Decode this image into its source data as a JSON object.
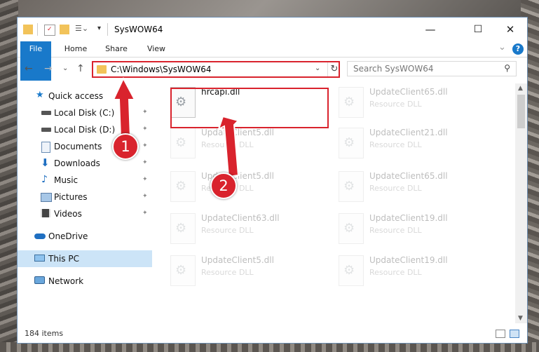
{
  "window": {
    "title": "SysWOW64",
    "controls": {
      "minimize": "—",
      "maximize": "☐",
      "close": "✕"
    }
  },
  "ribbon": {
    "tabs": [
      "File",
      "Home",
      "Share",
      "View"
    ],
    "expand_glyph": "⌄",
    "help_glyph": "?"
  },
  "address_bar": {
    "path": "C:\\Windows\\SysWOW64",
    "dropdown_glyph": "⌄",
    "refresh_glyph": "↻"
  },
  "search": {
    "placeholder": "Search SysWOW64",
    "icon_glyph": "⚲"
  },
  "nav_buttons": {
    "back": "←",
    "forward": "→",
    "recent": "⌄",
    "up": "↑"
  },
  "sidebar": {
    "items": [
      {
        "label": "Quick access",
        "icon": "star-icon",
        "pinned": false
      },
      {
        "label": "Local Disk (C:)",
        "icon": "drive-icon",
        "pinned": true
      },
      {
        "label": "Local Disk (D:)",
        "icon": "drive-icon",
        "pinned": true
      },
      {
        "label": "Documents",
        "icon": "documents-icon",
        "pinned": true
      },
      {
        "label": "Downloads",
        "icon": "download-icon",
        "pinned": true
      },
      {
        "label": "Music",
        "icon": "music-icon",
        "pinned": true
      },
      {
        "label": "Pictures",
        "icon": "pictures-icon",
        "pinned": true
      },
      {
        "label": "Videos",
        "icon": "videos-icon",
        "pinned": true
      },
      {
        "label": "OneDrive",
        "icon": "cloud-icon",
        "pinned": false
      },
      {
        "label": "This PC",
        "icon": "computer-icon",
        "pinned": false,
        "selected": true
      },
      {
        "label": "Network",
        "icon": "network-icon",
        "pinned": false
      }
    ],
    "pin_glyph": "✦"
  },
  "files": [
    {
      "name": "hrcapi.dll",
      "type": "",
      "highlighted": true
    },
    {
      "name": "UpdateClient65.dll",
      "type": "Resource DLL"
    },
    {
      "name": "UpdateClient5.dll",
      "type": "Resource DLL"
    },
    {
      "name": "UpdateClient21.dll",
      "type": "Resource DLL"
    },
    {
      "name": "UpdateClient5.dll",
      "type": "Resource DLL"
    },
    {
      "name": "UpdateClient65.dll",
      "type": "Resource DLL"
    },
    {
      "name": "UpdateClient63.dll",
      "type": "Resource DLL"
    },
    {
      "name": "UpdateClient19.dll",
      "type": "Resource DLL"
    },
    {
      "name": "UpdateClient5.dll",
      "type": "Resource DLL"
    },
    {
      "name": "UpdateClient19.dll",
      "type": "Resource DLL"
    }
  ],
  "status_bar": {
    "item_count": "184 items"
  },
  "annotations": {
    "callout_1": "1",
    "callout_2": "2",
    "highlight_color": "#d9232d"
  },
  "colors": {
    "accent": "#1979ca",
    "selected_bg": "#cce4f7"
  }
}
